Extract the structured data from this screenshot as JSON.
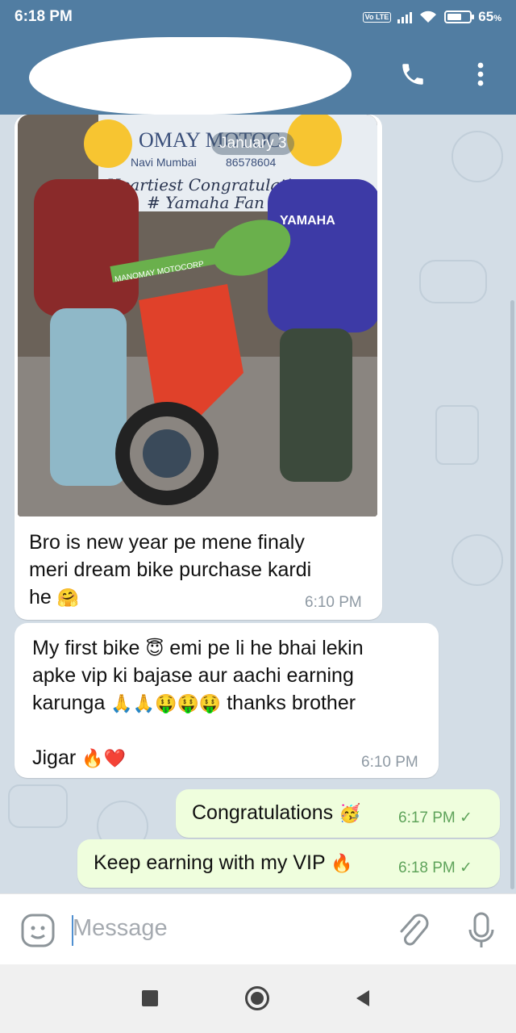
{
  "status_bar": {
    "time": "6:18 PM",
    "volte": "Vo LTE",
    "battery": "65",
    "battery_unit": "%",
    "battery_level": 0.65
  },
  "header": {
    "call_icon": "phone-icon",
    "menu_icon": "more-vertical-icon"
  },
  "chat": {
    "date_chip": "January 3",
    "messages": [
      {
        "line1": "Bro is new year pe mene finaly",
        "line2": "meri dream bike purchase kardi",
        "line3": "he",
        "emoji": "🤗",
        "time": "6:10 PM"
      },
      {
        "line1a": "My first bike",
        "emoji1": "😇",
        "line1b": "emi pe li he bhai lekin",
        "line2": "apke vip ki bajase aur aachi earning",
        "line3a": "karunga",
        "emoji_row": "🙏🙏🤑🤑🤑",
        "line3b": "thanks brother",
        "line5": "Jigar",
        "emoji_end": "🔥❤️",
        "time": "6:10 PM"
      },
      {
        "text": "Congratulations",
        "emoji": "🥳",
        "time": "6:17 PM",
        "check": "✓"
      },
      {
        "text": "Keep earning with my VIP",
        "emoji": "🔥",
        "time": "6:18 PM",
        "check": "✓"
      }
    ],
    "photo_text": {
      "sign_top": "OMAY MOTOC",
      "sign_city": "Navi Mumbai",
      "sign_phone": "86578604",
      "sign_line1": "Heartiest Congratulatio",
      "sign_line2": "# Yamaha Fan",
      "shirt_text": "YAMAHA",
      "key_text": "MANOMAY MOTOCORP"
    }
  },
  "input": {
    "placeholder": "Message",
    "emoji_icon": "sticker-icon",
    "attach_icon": "paperclip-icon",
    "mic_icon": "microphone-icon"
  },
  "navbar": {
    "recent_icon": "square-icon",
    "home_icon": "circle-icon",
    "back_icon": "triangle-back-icon"
  },
  "colors": {
    "header": "#517da2",
    "bubble_in": "#ffffff",
    "bubble_out": "#effedd",
    "time_out": "#5ea35a"
  }
}
